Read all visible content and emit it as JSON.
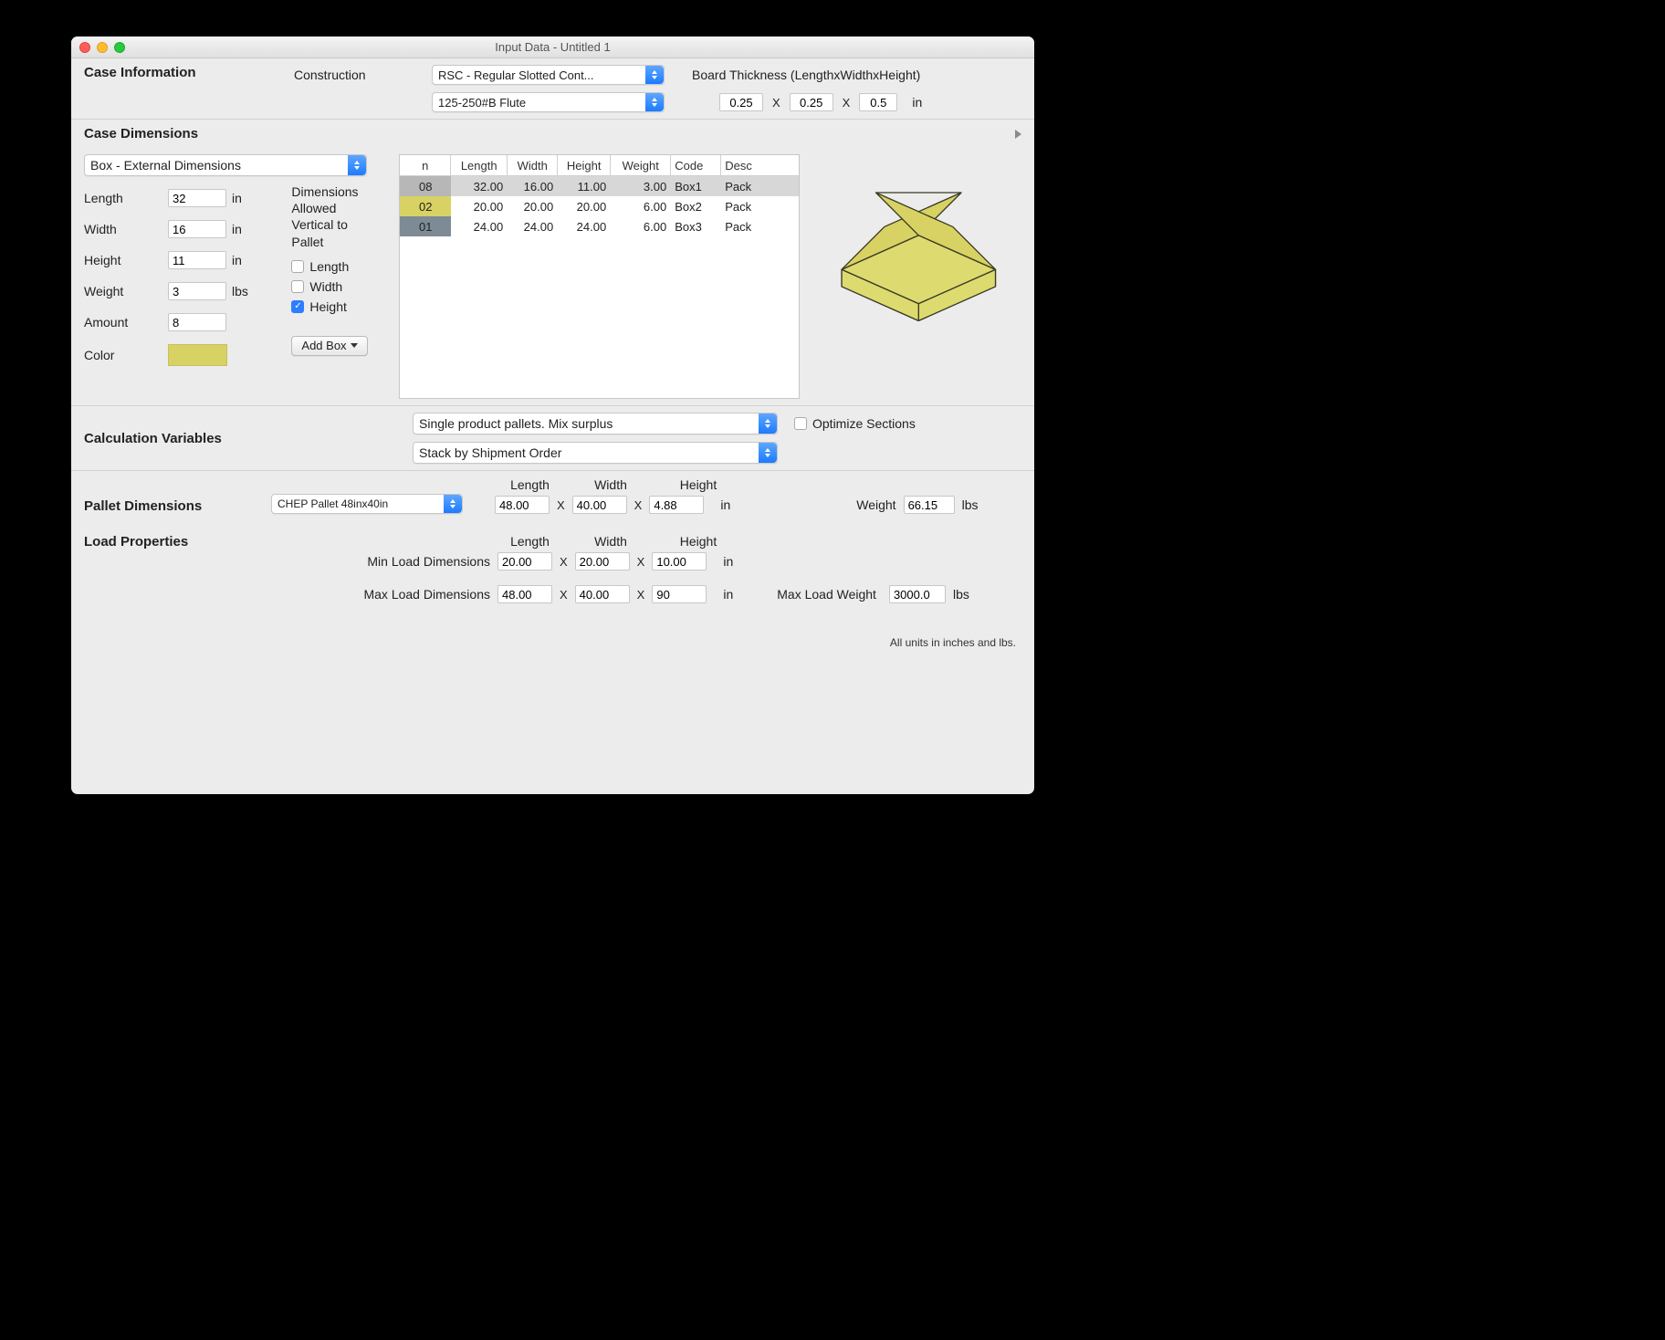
{
  "window": {
    "title": "Input Data - Untitled 1"
  },
  "caseInfo": {
    "heading": "Case Information",
    "constructionLabel": "Construction",
    "constructionValue": "RSC - Regular Slotted Cont...",
    "fluteValue": "125-250#B Flute",
    "boardThicknessLabel": "Board Thickness (LengthxWidthxHeight)",
    "btL": "0.25",
    "xSep": "X",
    "btW": "0.25",
    "btH": "0.5",
    "unit": "in"
  },
  "caseDim": {
    "heading": "Case Dimensions",
    "dimBasis": "Box - External Dimensions",
    "labels": {
      "length": "Length",
      "width": "Width",
      "height": "Height",
      "weight": "Weight",
      "amount": "Amount",
      "color": "Color",
      "unitLen": "in",
      "unitWt": "lbs"
    },
    "values": {
      "length": "32",
      "width": "16",
      "height": "11",
      "weight": "3",
      "amount": "8"
    },
    "allowedHeading1": "Dimensions",
    "allowedHeading2": "Allowed",
    "allowedHeading3": "Vertical to",
    "allowedHeading4": "Pallet",
    "chkLength": "Length",
    "chkWidth": "Width",
    "chkHeight": "Height",
    "addBox": "Add Box",
    "table": {
      "headers": {
        "n": "n",
        "length": "Length",
        "width": "Width",
        "height": "Height",
        "weight": "Weight",
        "code": "Code",
        "desc": "Desc"
      },
      "rows": [
        {
          "n": "08",
          "l": "32.00",
          "w": "16.00",
          "h": "11.00",
          "wt": "3.00",
          "code": "Box1",
          "desc": "Pack",
          "idxColor": "#b7b7b7",
          "selected": true
        },
        {
          "n": "02",
          "l": "20.00",
          "w": "20.00",
          "h": "20.00",
          "wt": "6.00",
          "code": "Box2",
          "desc": "Pack",
          "idxColor": "#d7d263",
          "selected": false
        },
        {
          "n": "01",
          "l": "24.00",
          "w": "24.00",
          "h": "24.00",
          "wt": "6.00",
          "code": "Box3",
          "desc": "Pack",
          "idxColor": "#7c8b95",
          "selected": false
        }
      ]
    }
  },
  "calcVars": {
    "heading": "Calculation Variables",
    "mixValue": "Single product pallets. Mix surplus",
    "stackValue": "Stack by Shipment Order",
    "optimize": "Optimize Sections"
  },
  "pallet": {
    "heading": "Pallet Dimensions",
    "typeValue": "CHEP Pallet 48inx40in",
    "colLength": "Length",
    "colWidth": "Width",
    "colHeight": "Height",
    "l": "48.00",
    "w": "40.00",
    "h": "4.88",
    "unit": "in",
    "weightLabel": "Weight",
    "weight": "66.15",
    "weightUnit": "lbs",
    "x": "X"
  },
  "load": {
    "heading": "Load Properties",
    "colLength": "Length",
    "colWidth": "Width",
    "colHeight": "Height",
    "minLabel": "Min Load Dimensions",
    "maxLabel": "Max Load Dimensions",
    "min": {
      "l": "20.00",
      "w": "20.00",
      "h": "10.00"
    },
    "max": {
      "l": "48.00",
      "w": "40.00",
      "h": "90"
    },
    "unit": "in",
    "x": "X",
    "maxWeightLabel": "Max Load Weight",
    "maxWeight": "3000.0",
    "maxWeightUnit": "lbs"
  },
  "footer": {
    "note": "All units in inches and lbs."
  }
}
